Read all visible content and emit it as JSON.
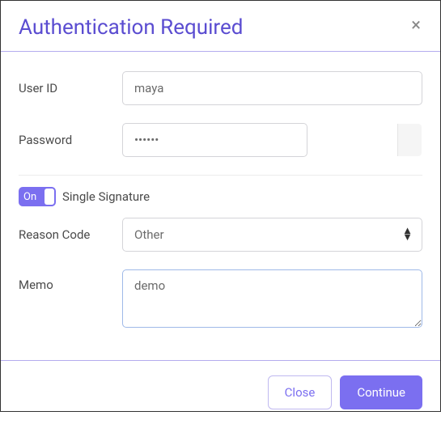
{
  "header": {
    "title": "Authentication Required"
  },
  "fields": {
    "user_id": {
      "label": "User ID",
      "value": "maya"
    },
    "password": {
      "label": "Password",
      "value": "••••••"
    },
    "single_signature": {
      "label": "Single Signature",
      "toggle_text": "On"
    },
    "reason_code": {
      "label": "Reason Code",
      "value": "Other"
    },
    "memo": {
      "label": "Memo",
      "value": "demo"
    }
  },
  "footer": {
    "close_label": "Close",
    "continue_label": "Continue"
  }
}
